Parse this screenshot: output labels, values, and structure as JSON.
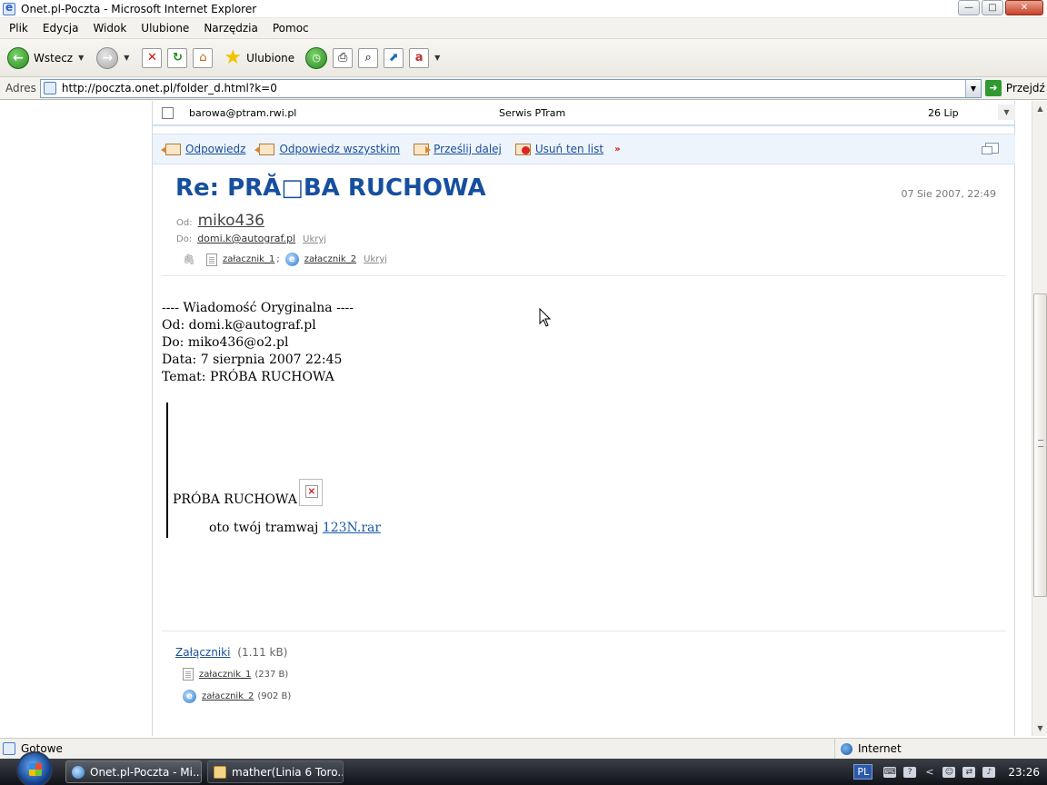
{
  "window": {
    "title": "Onet.pl-Poczta - Microsoft Internet Explorer",
    "buttons": {
      "minimize": "—",
      "maximize": "□",
      "close": "✕"
    }
  },
  "menu": [
    "Plik",
    "Edycja",
    "Widok",
    "Ulubione",
    "Narzędzia",
    "Pomoc"
  ],
  "toolbar": {
    "back_label": "Wstecz",
    "favorites_label": "Ulubione",
    "icons": [
      "back-icon",
      "forward-icon",
      "stop-icon",
      "refresh-icon",
      "home-icon",
      "favorites-icon",
      "history-icon",
      "print-icon",
      "search-icon",
      "window-icon",
      "translate-icon"
    ]
  },
  "address": {
    "label": "Adres",
    "url": "http://poczta.onet.pl/folder_d.html?k=0",
    "go_label": "Przejdź"
  },
  "message_list_row": {
    "from": "barowa@ptram.rwi.pl",
    "subject": "Serwis PTram",
    "date": "26 Lip"
  },
  "actions": {
    "reply": "Odpowiedz",
    "reply_all": "Odpowiedz wszystkim",
    "forward": "Prześlij dalej",
    "delete": "Usuń ten list",
    "more": "»"
  },
  "message": {
    "subject": "Re: PRĂ□BA RUCHOWA",
    "date": "07 Sie 2007, 22:49",
    "from_label": "Od:",
    "from": "miko436",
    "to_label": "Do:",
    "to": "domi.k@autograf.pl",
    "hide_label": "Ukryj",
    "attachments_inline": [
      {
        "name": "załacznik_1",
        "sep": ";"
      },
      {
        "name": "załacznik_2",
        "sep": ""
      }
    ],
    "body_lines": [
      "---- Wiadomość Oryginalna ----",
      "Od: domi.k@autograf.pl",
      "Do: miko436@o2.pl",
      "Data: 7 sierpnia 2007 22:45",
      "Temat: PRÓBA RUCHOWA"
    ],
    "quote_title": "PRÓBA RUCHOWA",
    "quote_text": "oto twój tramwaj",
    "quote_link": "123N.rar",
    "attachments_header": "Załączniki",
    "attachments_total": "(1.11 kB)",
    "attachments": [
      {
        "name": "załacznik_1",
        "size": "(237 B)"
      },
      {
        "name": "załacznik_2",
        "size": "(902 B)"
      }
    ]
  },
  "status": {
    "text": "Gotowe",
    "zone": "Internet"
  },
  "taskbar": {
    "tasks": [
      "Onet.pl-Poczta - Mi...",
      "mather(Linia 6 Toro..."
    ],
    "language": "PL",
    "clock": "23:26"
  }
}
